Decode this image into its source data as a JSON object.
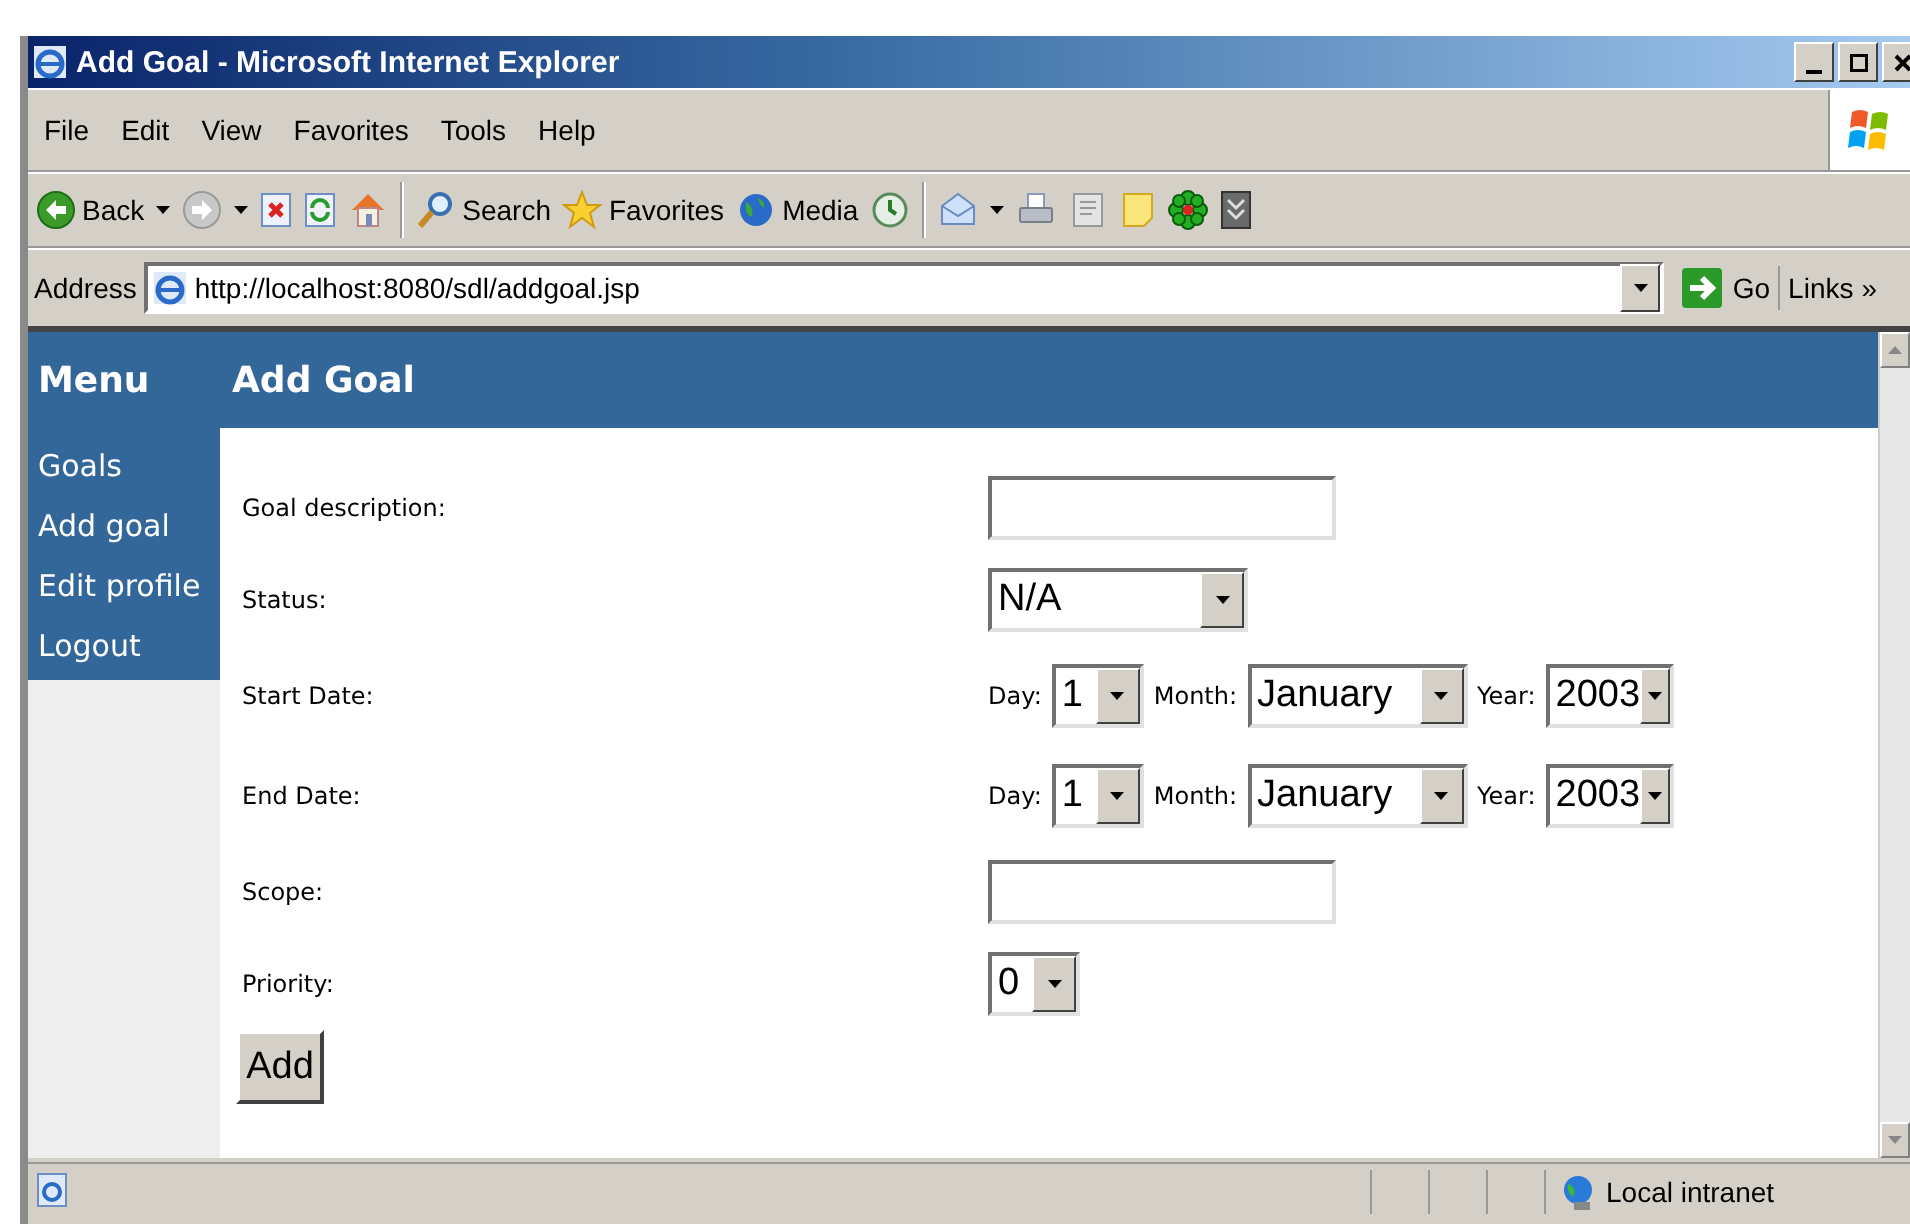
{
  "window": {
    "title": "Add Goal - Microsoft Internet Explorer"
  },
  "menu_bar": [
    "File",
    "Edit",
    "View",
    "Favorites",
    "Tools",
    "Help"
  ],
  "toolbar": [
    {
      "kind": "back",
      "label": "Back",
      "dropdown": true
    },
    {
      "kind": "forward",
      "dropdown": true
    },
    {
      "kind": "stop"
    },
    {
      "kind": "refresh"
    },
    {
      "kind": "home"
    },
    {
      "kind": "separator"
    },
    {
      "kind": "search",
      "label": "Search"
    },
    {
      "kind": "favorites",
      "label": "Favorites"
    },
    {
      "kind": "media",
      "label": "Media"
    },
    {
      "kind": "history"
    },
    {
      "kind": "separator"
    },
    {
      "kind": "mail",
      "dropdown": true
    },
    {
      "kind": "print"
    },
    {
      "kind": "edit"
    },
    {
      "kind": "note"
    },
    {
      "kind": "flower"
    },
    {
      "kind": "tool"
    }
  ],
  "address_bar": {
    "label": "Address",
    "url": "http://localhost:8080/sdl/addgoal.jsp",
    "go": "Go",
    "links": "Links",
    "more": "»"
  },
  "sidebar": {
    "heading": "Menu",
    "items": [
      "Goals",
      "Add goal",
      "Edit profile",
      "Logout"
    ]
  },
  "content": {
    "heading": "Add Goal",
    "fields": [
      {
        "kind": "text",
        "label": "Goal description:"
      },
      {
        "kind": "select",
        "label": "Status:",
        "value": "N/A"
      },
      {
        "kind": "date",
        "label": "Start Date:",
        "parts": [
          {
            "label": "Day:",
            "value": "1"
          },
          {
            "label": "Month:",
            "value": "January"
          },
          {
            "label": "Year:",
            "value": "2003"
          }
        ]
      },
      {
        "kind": "date",
        "label": "End Date:",
        "parts": [
          {
            "label": "Day:",
            "value": "1"
          },
          {
            "label": "Month:",
            "value": "January"
          },
          {
            "label": "Year:",
            "value": "2003"
          }
        ]
      },
      {
        "kind": "text",
        "label": "Scope:"
      },
      {
        "kind": "select",
        "label": "Priority:",
        "value": "0"
      }
    ],
    "button": "Add"
  },
  "status_bar": {
    "zone": "Local intranet"
  }
}
